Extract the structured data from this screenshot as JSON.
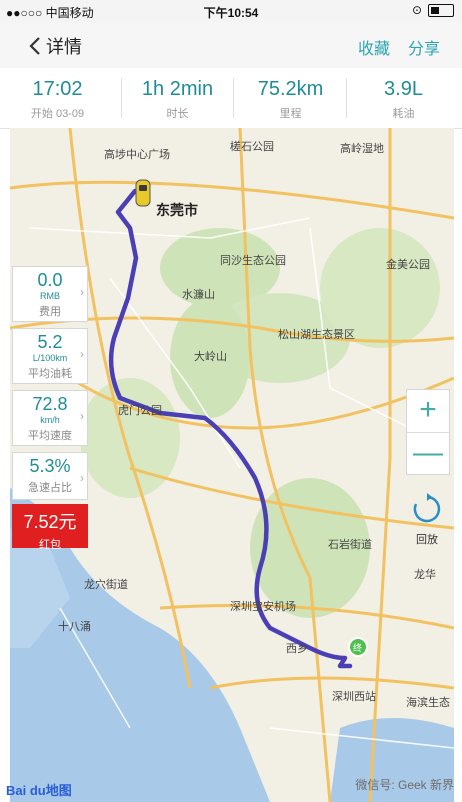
{
  "status": {
    "carrier": "●●○○○ 中国移动",
    "time": "下午10:54"
  },
  "nav": {
    "back_label": "详情",
    "favorite_label": "收藏",
    "share_label": "分享"
  },
  "stats": [
    {
      "value": "17:02",
      "key": "开始 03-09"
    },
    {
      "value": "1h 2min",
      "key": "时长"
    },
    {
      "value": "75.2km",
      "key": "里程"
    },
    {
      "value": "3.9L",
      "key": "耗油"
    }
  ],
  "cards": [
    {
      "value": "0.0",
      "unit": "RMB",
      "key": "费用"
    },
    {
      "value": "5.2",
      "unit": "L/100km",
      "key": "平均油耗"
    },
    {
      "value": "72.8",
      "unit": "km/h",
      "key": "平均速度"
    },
    {
      "value": "5.3%",
      "unit": "",
      "key": "急速占比"
    },
    {
      "value": "7.52元",
      "unit": "",
      "key": "红包"
    }
  ],
  "map": {
    "city": "东莞市",
    "pois": [
      "高埗中心广场",
      "槎石公园",
      "高岭湿地",
      "同沙生态公园",
      "金美公园",
      "水濂山",
      "松山湖生态景区",
      "大岭山",
      "虎门公园",
      "石岩街道",
      "龙华",
      "龙穴街道",
      "十八涌",
      "深圳宝安机场",
      "西乡",
      "深圳西站",
      "海滨生态"
    ]
  },
  "controls": {
    "zoom_in": "+",
    "zoom_out": "—",
    "replay_label": "回放"
  },
  "footer": {
    "logo_text": "Bai du地图",
    "watermark": "微信号: Geek 新界"
  },
  "colors": {
    "accent": "#2aa5b0",
    "route": "#4b3fb5",
    "red_packet": "#e02020"
  }
}
